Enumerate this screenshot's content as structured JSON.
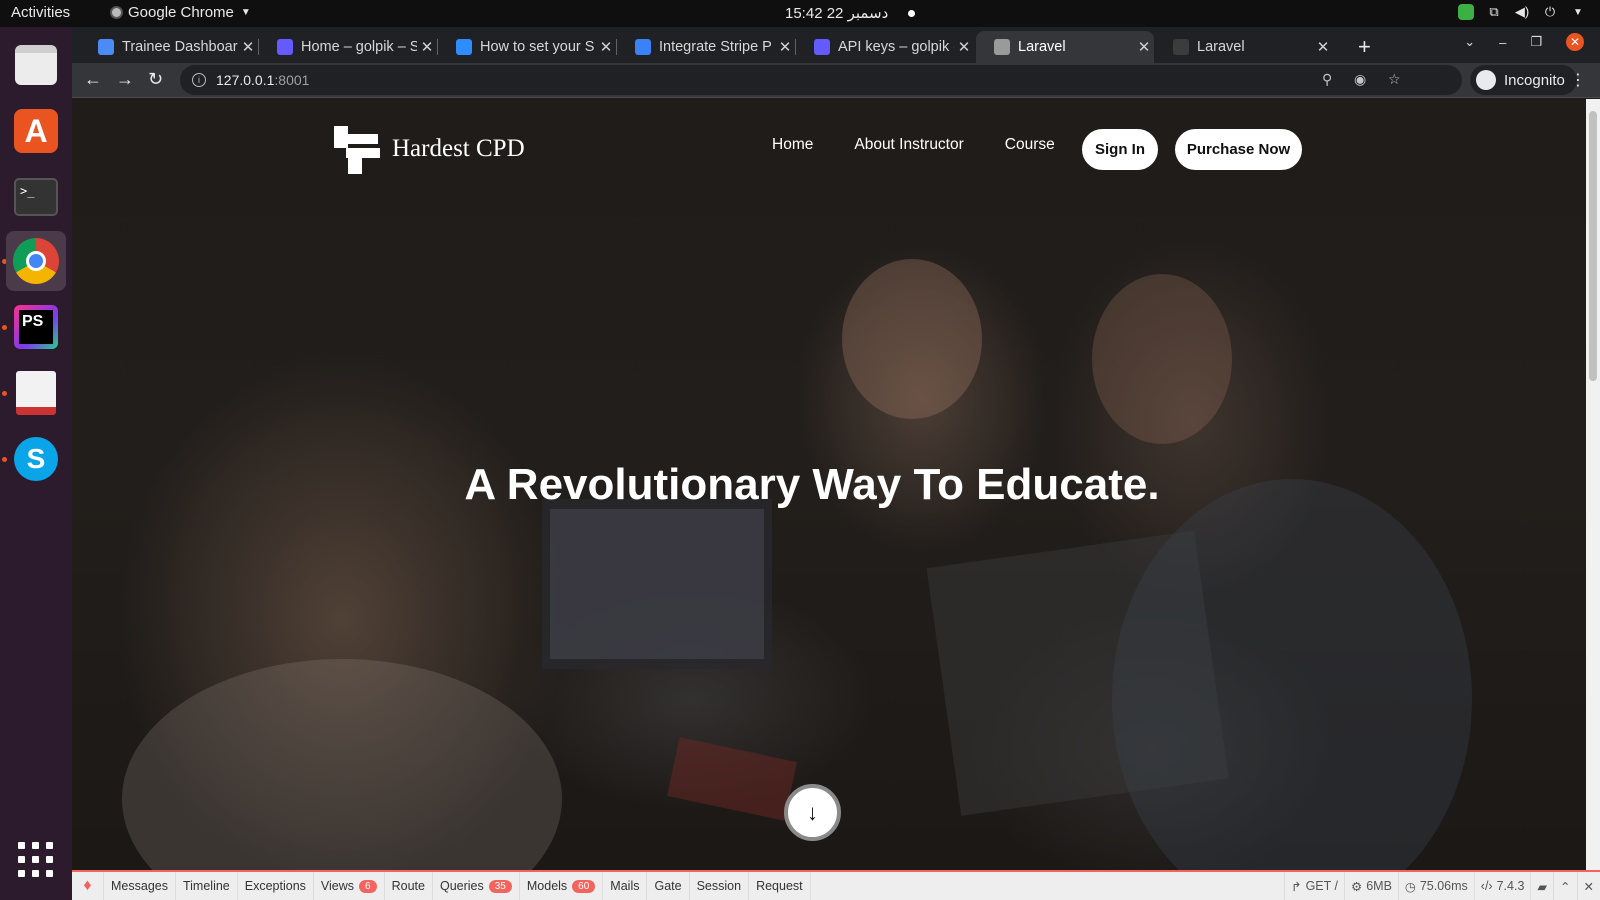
{
  "system_bar": {
    "activities": "Activities",
    "app_name": "Google Chrome",
    "clock": "15:42  22 دسمبر"
  },
  "dock": {
    "items": [
      "files-icon",
      "software-store-icon",
      "terminal-icon",
      "chrome-icon",
      "phpstorm-icon",
      "document-viewer-icon",
      "skype-icon",
      "show-apps-icon"
    ]
  },
  "browser": {
    "tabs": [
      {
        "title": "Trainee Dashboard",
        "favicon_color": "#4c8bf5",
        "active": false
      },
      {
        "title": "Home – golpik – S",
        "favicon_color": "#635bff",
        "active": false
      },
      {
        "title": "How to set your S",
        "favicon_color": "#2d8cff",
        "active": false
      },
      {
        "title": "Integrate Stripe P",
        "favicon_color": "#3b82f6",
        "active": false
      },
      {
        "title": "API keys – golpik -",
        "favicon_color": "#635bff",
        "active": false
      },
      {
        "title": "Laravel",
        "favicon_color": "#9a9a9a",
        "active": true
      },
      {
        "title": "Laravel",
        "favicon_color": "#3c3c3c",
        "active": false
      }
    ],
    "url_host": "127.0.0.1",
    "url_port": ":8001",
    "incognito_label": "Incognito"
  },
  "site": {
    "brand": "Hardest CPD",
    "nav": [
      "Home",
      "About Instructor",
      "Course"
    ],
    "sign_in": "Sign In",
    "purchase": "Purchase Now",
    "hero_title": "A Revolutionary Way To Educate."
  },
  "debugbar": {
    "tabs": [
      {
        "label": "Messages"
      },
      {
        "label": "Timeline"
      },
      {
        "label": "Exceptions"
      },
      {
        "label": "Views",
        "badge": "6"
      },
      {
        "label": "Route"
      },
      {
        "label": "Queries",
        "badge": "35"
      },
      {
        "label": "Models",
        "badge": "60"
      },
      {
        "label": "Mails"
      },
      {
        "label": "Gate"
      },
      {
        "label": "Session"
      },
      {
        "label": "Request"
      }
    ],
    "method": "GET /",
    "memory": "6MB",
    "time": "75.06ms",
    "php": "7.4.3"
  }
}
